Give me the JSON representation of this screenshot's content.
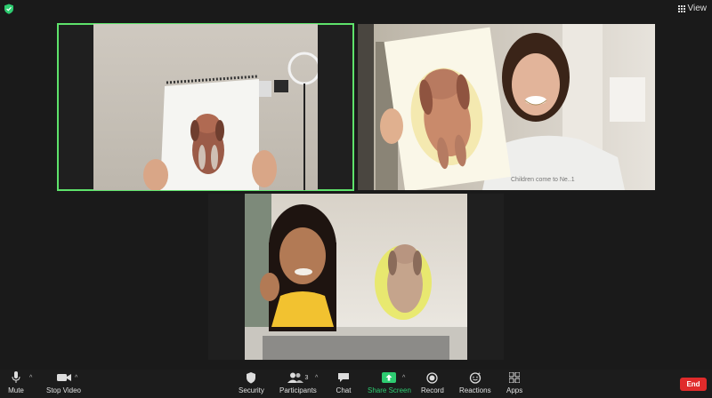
{
  "top": {
    "view_label": "View"
  },
  "participants_count": "3",
  "toolbar": {
    "mute": "Mute",
    "stop_video": "Stop Video",
    "security": "Security",
    "participants": "Participants",
    "chat": "Chat",
    "share_screen": "Share Screen",
    "record": "Record",
    "reactions": "Reactions",
    "apps": "Apps",
    "end": "End"
  },
  "colors": {
    "active_speaker": "#5ee26b",
    "share_green": "#2ecc71",
    "end_red": "#e02b2b",
    "background": "#1a1a1a"
  },
  "shirt_text": "Children come to Ne..1"
}
